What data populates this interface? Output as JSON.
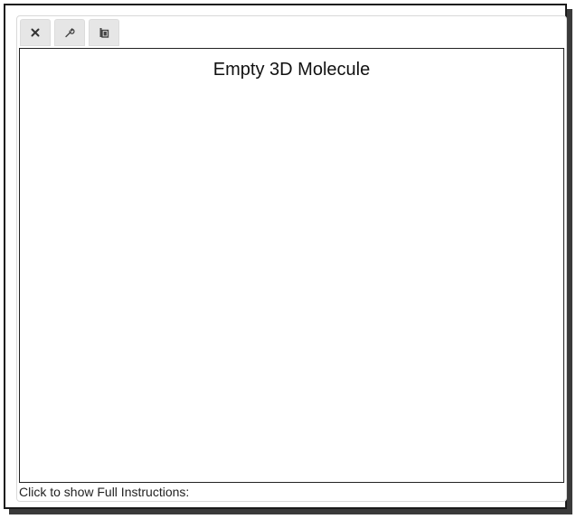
{
  "toolbar": {
    "buttons": [
      {
        "icon": "close-icon"
      },
      {
        "icon": "wrench-icon"
      },
      {
        "icon": "copy-icon"
      }
    ]
  },
  "viewer": {
    "title": "Empty 3D Molecule"
  },
  "instructions": {
    "label": "Click to show Full Instructions:"
  }
}
